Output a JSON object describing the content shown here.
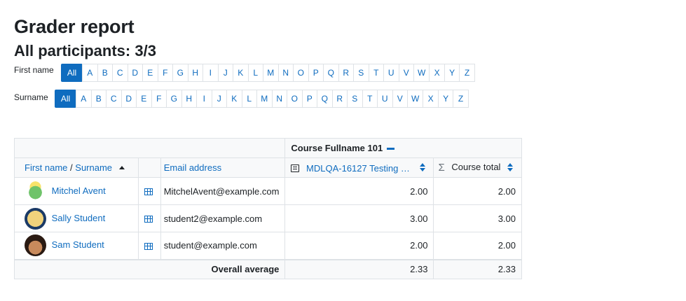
{
  "page": {
    "title": "Grader report",
    "participants": "All participants: 3/3"
  },
  "initials": {
    "first_label": "First name",
    "surname_label": "Surname",
    "all_label": "All",
    "letters": [
      "A",
      "B",
      "C",
      "D",
      "E",
      "F",
      "G",
      "H",
      "I",
      "J",
      "K",
      "L",
      "M",
      "N",
      "O",
      "P",
      "Q",
      "R",
      "S",
      "T",
      "U",
      "V",
      "W",
      "X",
      "Y",
      "Z"
    ]
  },
  "table": {
    "course_header": "Course Fullname 101",
    "col_first_name": "First name",
    "col_sep": "/",
    "col_surname": "Surname",
    "col_email": "Email address",
    "col_assignment": "MDLQA-16127 Testing M...",
    "col_total": "Course total",
    "rows": [
      {
        "name": "Mitchel Avent",
        "email": "MitchelAvent@example.com",
        "grade": "2.00",
        "total": "2.00"
      },
      {
        "name": "Sally Student",
        "email": "student2@example.com",
        "grade": "3.00",
        "total": "3.00"
      },
      {
        "name": "Sam Student",
        "email": "student@example.com",
        "grade": "2.00",
        "total": "2.00"
      }
    ],
    "avg_label": "Overall average",
    "avg_grade": "2.33",
    "avg_total": "2.33"
  },
  "colors": {
    "link": "#0f6cbf",
    "border": "#dee2e6",
    "header_bg": "#f8f9fa"
  }
}
